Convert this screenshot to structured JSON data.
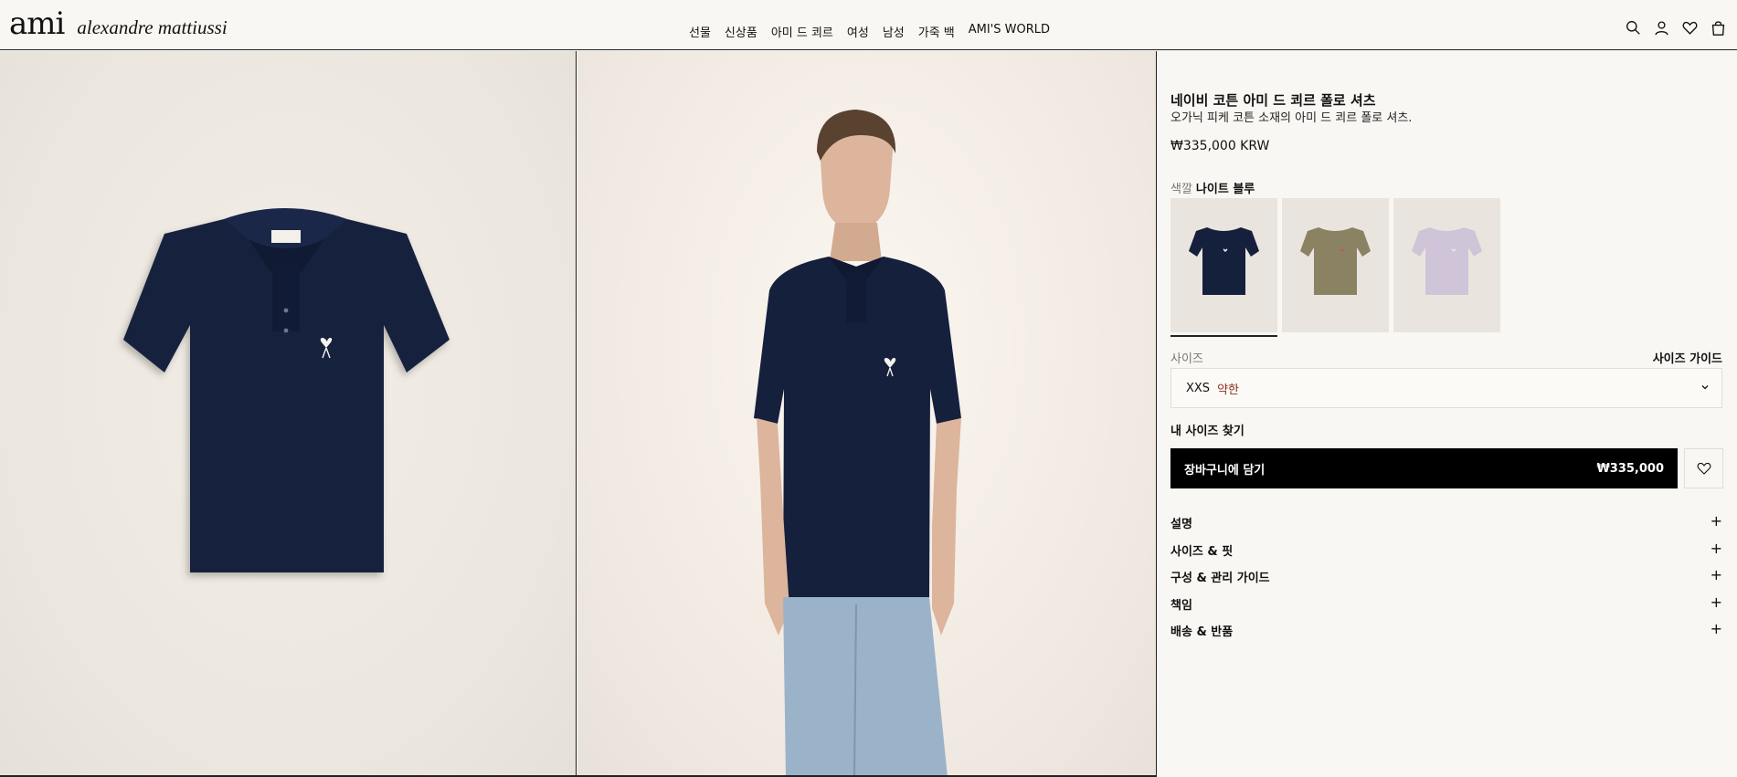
{
  "header": {
    "logo_mark": "ami",
    "logo_name": "alexandre mattiussi",
    "nav": [
      "선물",
      "신상품",
      "아미 드 쾨르",
      "여성",
      "남성",
      "가죽 백",
      "AMI'S WORLD"
    ],
    "icons": [
      "search-icon",
      "account-icon",
      "heart-icon",
      "bag-icon"
    ]
  },
  "product": {
    "title": "네이비 코튼 아미 드 쾨르 폴로 셔츠",
    "subtitle": "오가닉 피케 코튼 소재의 아미 드 쾨르 폴로 셔츠.",
    "price": "₩335,000 KRW",
    "color_label": "색깔",
    "color_value": "나이트 블루",
    "swatches": [
      {
        "color": "#15203d"
      },
      {
        "color": "#8a8263"
      },
      {
        "color": "#cfc4d8"
      }
    ],
    "size_label": "사이즈",
    "size_guide": "사이즈 가이드",
    "size_value": "XXS",
    "size_stock": "약한",
    "find_size": "내 사이즈 찾기",
    "add_to_cart": "장바구니에 담기",
    "cart_price": "₩335,000",
    "accordions": [
      "설명",
      "사이즈 & 핏",
      "구성 & 관리 가이드",
      "책임",
      "배송 & 반품"
    ]
  },
  "colors": {
    "navy": "#15203d",
    "stock_text": "#8b2f1c",
    "background": "#f8f7f3"
  }
}
